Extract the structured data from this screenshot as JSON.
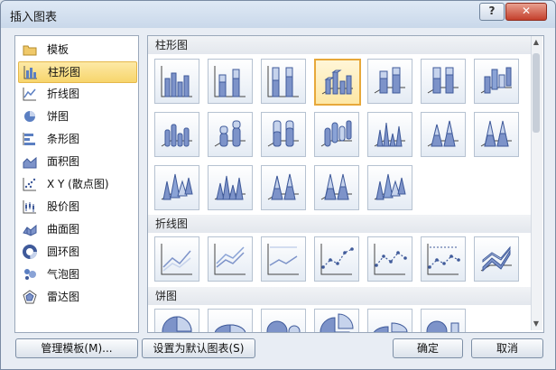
{
  "window": {
    "title": "插入图表"
  },
  "titlebar": {
    "help_label": "?",
    "close_label": "✕"
  },
  "sidebar": {
    "items": [
      {
        "label": "模板",
        "icon": "folder-icon"
      },
      {
        "label": "柱形图",
        "icon": "column-chart-icon",
        "selected": true
      },
      {
        "label": "折线图",
        "icon": "line-chart-icon"
      },
      {
        "label": "饼图",
        "icon": "pie-chart-icon"
      },
      {
        "label": "条形图",
        "icon": "bar-chart-icon"
      },
      {
        "label": "面积图",
        "icon": "area-chart-icon"
      },
      {
        "label": "X Y (散点图)",
        "icon": "scatter-chart-icon"
      },
      {
        "label": "股价图",
        "icon": "stock-chart-icon"
      },
      {
        "label": "曲面图",
        "icon": "surface-chart-icon"
      },
      {
        "label": "圆环图",
        "icon": "doughnut-chart-icon"
      },
      {
        "label": "气泡图",
        "icon": "bubble-chart-icon"
      },
      {
        "label": "雷达图",
        "icon": "radar-chart-icon"
      }
    ]
  },
  "gallery": {
    "sections": [
      {
        "label": "柱形图"
      },
      {
        "label": "折线图"
      },
      {
        "label": "饼图"
      }
    ]
  },
  "footer": {
    "manage_label": "管理模板(M)...",
    "set_default_label": "设置为默认图表(S)",
    "ok_label": "确定",
    "cancel_label": "取消"
  },
  "colors": {
    "accent": "#e7a83a",
    "selection": "#fde7a5",
    "chart_fill": "#7d93c9"
  }
}
